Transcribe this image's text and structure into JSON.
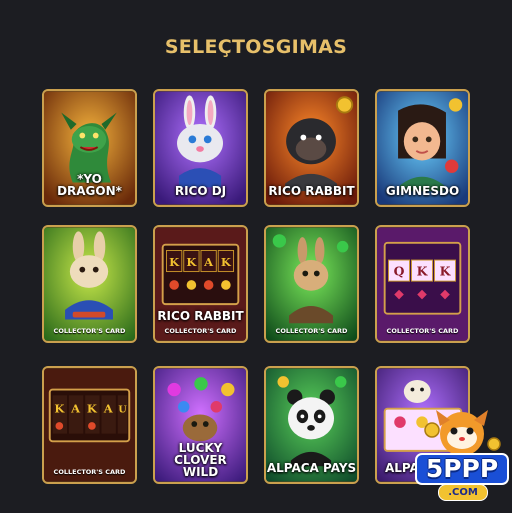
{
  "page_title": "SELEÇTOSGIMAS",
  "cards": [
    {
      "label": "*YO DRAGON*",
      "sub": ""
    },
    {
      "label": "RICO DJ",
      "sub": ""
    },
    {
      "label": "RICO RABBIT",
      "sub": ""
    },
    {
      "label": "GIMNESDO",
      "sub": ""
    },
    {
      "label": "",
      "sub": "COLLECTOR'S CARD"
    },
    {
      "label": "RICO RABBIT",
      "sub": "COLLECTOR'S CARD"
    },
    {
      "label": "",
      "sub": "COLLECTOR'S CARD"
    },
    {
      "label": "",
      "sub": "COLLECTOR'S CARD"
    },
    {
      "label": "",
      "sub": "COLLECTOR'S CARD"
    },
    {
      "label": "LUCKY CLOVER WILD",
      "sub": ""
    },
    {
      "label": "ALPACA PAYS",
      "sub": ""
    },
    {
      "label": "ALPA",
      "sub": ""
    }
  ],
  "reel_symbols": {
    "card_6": [
      "K",
      "K",
      "A",
      "K"
    ],
    "card_8": [
      "Q",
      "K",
      "K"
    ],
    "card_9": [
      "K",
      "A",
      "K",
      "A",
      "U"
    ]
  },
  "brand": {
    "name": "5PPP",
    "domain": ".COM"
  },
  "colors": {
    "accent_gold": "#e7c06a",
    "background": "#1c1d22",
    "card_border": "#caa04e"
  }
}
